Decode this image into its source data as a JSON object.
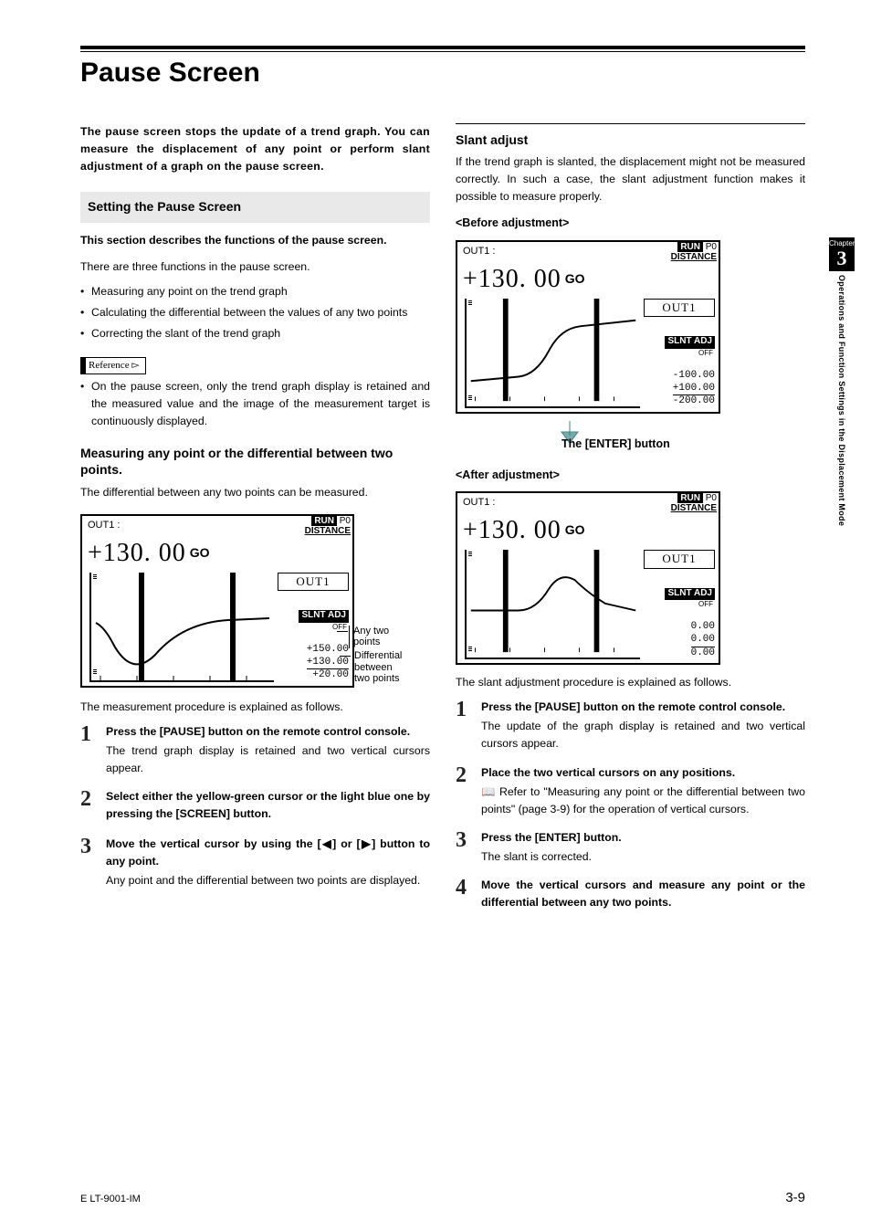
{
  "sidebar": {
    "chapter_label": "Chapter",
    "chapter_num": "3",
    "vtext": "Operations and Function Settings in the Displacement Mode"
  },
  "heading": "Pause Screen",
  "intro": "The pause screen stops the update of a trend graph. You can measure the displacement of any point or perform slant adjustment of a graph on the pause screen.",
  "section1": {
    "head": "Setting the Pause Screen",
    "lead": "This section describes the functions of the pause screen.",
    "body": "There are three functions in the pause screen.",
    "bullets": [
      "Measuring any point on the trend graph",
      "Calculating the differential between the values of any two points",
      "Correcting the slant of the trend graph"
    ],
    "ref_label": "Reference",
    "ref_text": "On the pause screen, only the trend graph display is retained and the measured value and the image of the measurement target is continuously displayed."
  },
  "section2": {
    "head": "Measuring any point or the differential between two points.",
    "body": "The differential between any two points can be measured.",
    "caption": "The measurement procedure is explained as follows."
  },
  "lcd": {
    "out_lbl": "OUT1 :",
    "value": "+130. 00",
    "go": "GO",
    "run": "RUN",
    "p0": "P0",
    "distance": "DISTANCE",
    "out_box": "OUT1",
    "slnt": "SLNT ADJ",
    "off": "OFF"
  },
  "lcd_left_vals": [
    "+150.00",
    "+130.00",
    "+20.00"
  ],
  "annot": {
    "l1a": "Any two",
    "l1b": "points",
    "l2a": "Differential",
    "l2b": "between",
    "l2c": "two points"
  },
  "steps_left": [
    {
      "n": "1",
      "t": "Press the [PAUSE] button on the remote control console.",
      "d": "The trend graph display is retained and two vertical cursors appear."
    },
    {
      "n": "2",
      "t": "Select either the yellow-green cursor or the light blue one by pressing the [SCREEN] button.",
      "d": ""
    },
    {
      "n": "3",
      "t": "Move the vertical cursor by using the [◀] or [▶] button to any point.",
      "d": "Any point and the differential between two points are displayed."
    }
  ],
  "slant": {
    "head": "Slant adjust",
    "body": "If the trend graph is slanted, the displacement might not be measured correctly. In such a case, the slant adjustment function makes it possible to measure properly.",
    "before": "<Before adjustment>",
    "enter": "The [ENTER] button",
    "after": "<After adjustment>",
    "caption": "The slant adjustment procedure is explained as follows."
  },
  "lcd_before_vals": [
    "-100.00",
    "+100.00",
    "-200.00"
  ],
  "lcd_after_vals": [
    "0.00",
    "0.00",
    "0.00"
  ],
  "steps_right": [
    {
      "n": "1",
      "t": "Press the [PAUSE] button on the remote control console.",
      "d": "The update of the graph display is retained and two vertical cursors appear."
    },
    {
      "n": "2",
      "t": "Place the two vertical cursors on any positions.",
      "d": "📖 Refer to \"Measuring any point or the differential between two points\" (page 3-9) for the operation of vertical cursors."
    },
    {
      "n": "3",
      "t": "Press the [ENTER] button.",
      "d": "The slant is corrected."
    },
    {
      "n": "4",
      "t": "Move the vertical cursors and measure any point or the differential between any two points.",
      "d": ""
    }
  ],
  "footer": {
    "left": "E LT-9001-IM",
    "right": "3-9"
  }
}
